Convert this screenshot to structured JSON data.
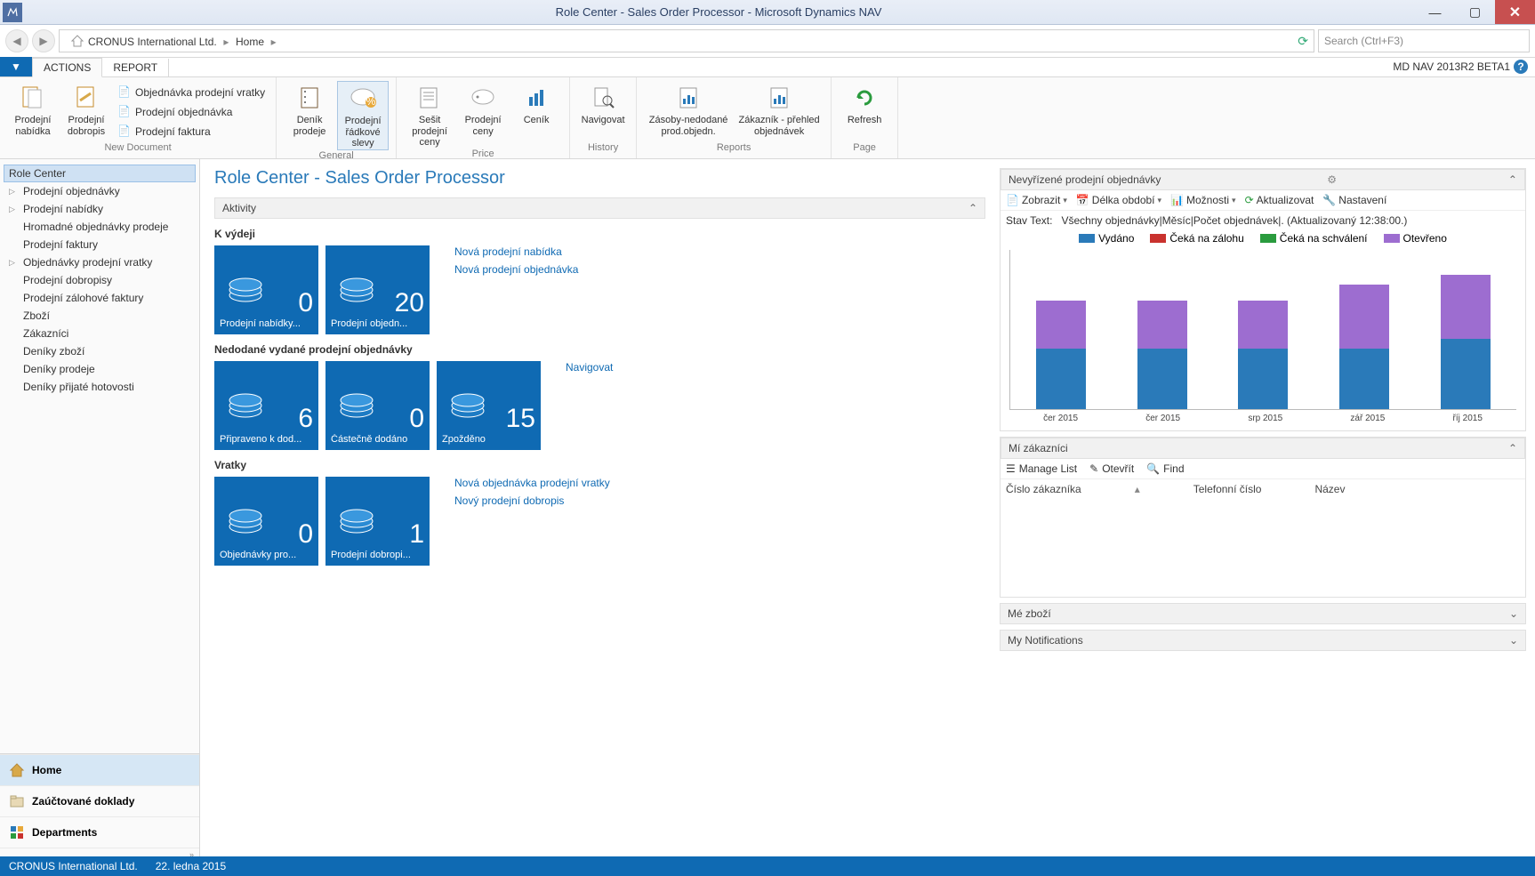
{
  "window_title": "Role Center - Sales Order Processor - Microsoft Dynamics NAV",
  "breadcrumb": {
    "company": "CRONUS International Ltd.",
    "page": "Home"
  },
  "search_placeholder": "Search (Ctrl+F3)",
  "tabs": {
    "actions": "ACTIONS",
    "report": "REPORT"
  },
  "version_label": "MD NAV 2013R2 BETA1",
  "ribbon": {
    "new_doc": {
      "label": "New Document",
      "nabidka": "Prodejní nabídka",
      "dobropis": "Prodejní dobropis",
      "small1": "Objednávka prodejní vratky",
      "small2": "Prodejní objednávka",
      "small3": "Prodejní faktura"
    },
    "general": {
      "label": "General",
      "denik": "Deník prodeje",
      "radky": "Prodejní řádkové slevy"
    },
    "price": {
      "label": "Price",
      "sesit": "Sešit prodejní ceny",
      "ceny": "Prodejní ceny",
      "cenik": "Ceník"
    },
    "history": {
      "label": "History",
      "navigovat": "Navigovat"
    },
    "reports": {
      "label": "Reports",
      "zasoby": "Zásoby-nedodané prod.objedn.",
      "zakaznik": "Zákazník - přehled objednávek"
    },
    "page": {
      "label": "Page",
      "refresh": "Refresh"
    }
  },
  "nav_items": [
    "Role Center",
    "Prodejní objednávky",
    "Prodejní nabídky",
    "Hromadné objednávky prodeje",
    "Prodejní faktury",
    "Objednávky prodejní vratky",
    "Prodejní dobropisy",
    "Prodejní zálohové faktury",
    "Zboží",
    "Zákazníci",
    "Deníky zboží",
    "Deníky prodeje",
    "Deníky přijaté hotovosti"
  ],
  "nav_exp": [
    false,
    true,
    true,
    false,
    false,
    true,
    false,
    false,
    false,
    false,
    false,
    false,
    false
  ],
  "nav_buttons": {
    "home": "Home",
    "posted": "Zaúčtované doklady",
    "dept": "Departments"
  },
  "page_title": "Role Center - Sales Order Processor",
  "activities": {
    "header": "Aktivity",
    "s1": {
      "title": "K výdeji",
      "tiles": [
        {
          "n": "0",
          "l": "Prodejní nabídky..."
        },
        {
          "n": "20",
          "l": "Prodejní objedn..."
        }
      ],
      "links": [
        "Nová prodejní nabídka",
        "Nová prodejní objednávka"
      ]
    },
    "s2": {
      "title": "Nedodané vydané prodejní objednávky",
      "tiles": [
        {
          "n": "6",
          "l": "Připraveno k dod..."
        },
        {
          "n": "0",
          "l": "Částečně dodáno"
        },
        {
          "n": "15",
          "l": "Zpožděno"
        }
      ],
      "links": [
        "Navigovat"
      ]
    },
    "s3": {
      "title": "Vratky",
      "tiles": [
        {
          "n": "0",
          "l": "Objednávky pro..."
        },
        {
          "n": "1",
          "l": "Prodejní dobropi..."
        }
      ],
      "links": [
        "Nová objednávka prodejní vratky",
        "Nový prodejní dobropis"
      ]
    }
  },
  "chart_part": {
    "header": "Nevyřízené prodejní objednávky",
    "toolbar": {
      "zobrazit": "Zobrazit",
      "delka": "Délka období",
      "moznosti": "Možnosti",
      "aktualizovat": "Aktualizovat",
      "nastaveni": "Nastavení"
    },
    "status_label": "Stav Text:",
    "status_text": "Všechny objednávky|Měsíc|Počet objednávek|. (Aktualizovaný 12:38:00.)",
    "legend": {
      "vydano": "Vydáno",
      "zaloha": "Čeká na zálohu",
      "schvaleni": "Čeká na schválení",
      "otevreno": "Otevřeno"
    },
    "colors": {
      "vydano": "#2a7ab9",
      "zaloha": "#c9322e",
      "schvaleni": "#2a9b3e",
      "otevreno": "#9d6dd0"
    }
  },
  "chart_data": {
    "type": "bar",
    "categories": [
      "čer 2015",
      "čer 2015",
      "srp 2015",
      "zář 2015",
      "říj 2015"
    ],
    "series": [
      {
        "name": "Vydáno",
        "values": [
          19,
          19,
          19,
          19,
          22
        ]
      },
      {
        "name": "Čeká na zálohu",
        "values": [
          0,
          0,
          0,
          0,
          0
        ]
      },
      {
        "name": "Čeká na schválení",
        "values": [
          0,
          0,
          0,
          0,
          0
        ]
      },
      {
        "name": "Otevřeno",
        "values": [
          15,
          15,
          15,
          20,
          20
        ]
      }
    ],
    "ylim": [
      0,
      50
    ],
    "yticks": [
      0,
      10,
      20,
      30,
      40,
      50
    ],
    "xlabel": "",
    "ylabel": "",
    "title": "Nevyřízené prodejní objednávky"
  },
  "customers": {
    "header": "Mí zákazníci",
    "toolbar": {
      "manage": "Manage List",
      "open": "Otevřít",
      "find": "Find"
    },
    "cols": {
      "c1": "Číslo zákazníka",
      "c2": "Telefonní číslo",
      "c3": "Název"
    }
  },
  "collapsed": {
    "zbozi": "Mé zboží",
    "notif": "My Notifications"
  },
  "statusbar": {
    "company": "CRONUS International Ltd.",
    "date": "22. ledna 2015"
  }
}
